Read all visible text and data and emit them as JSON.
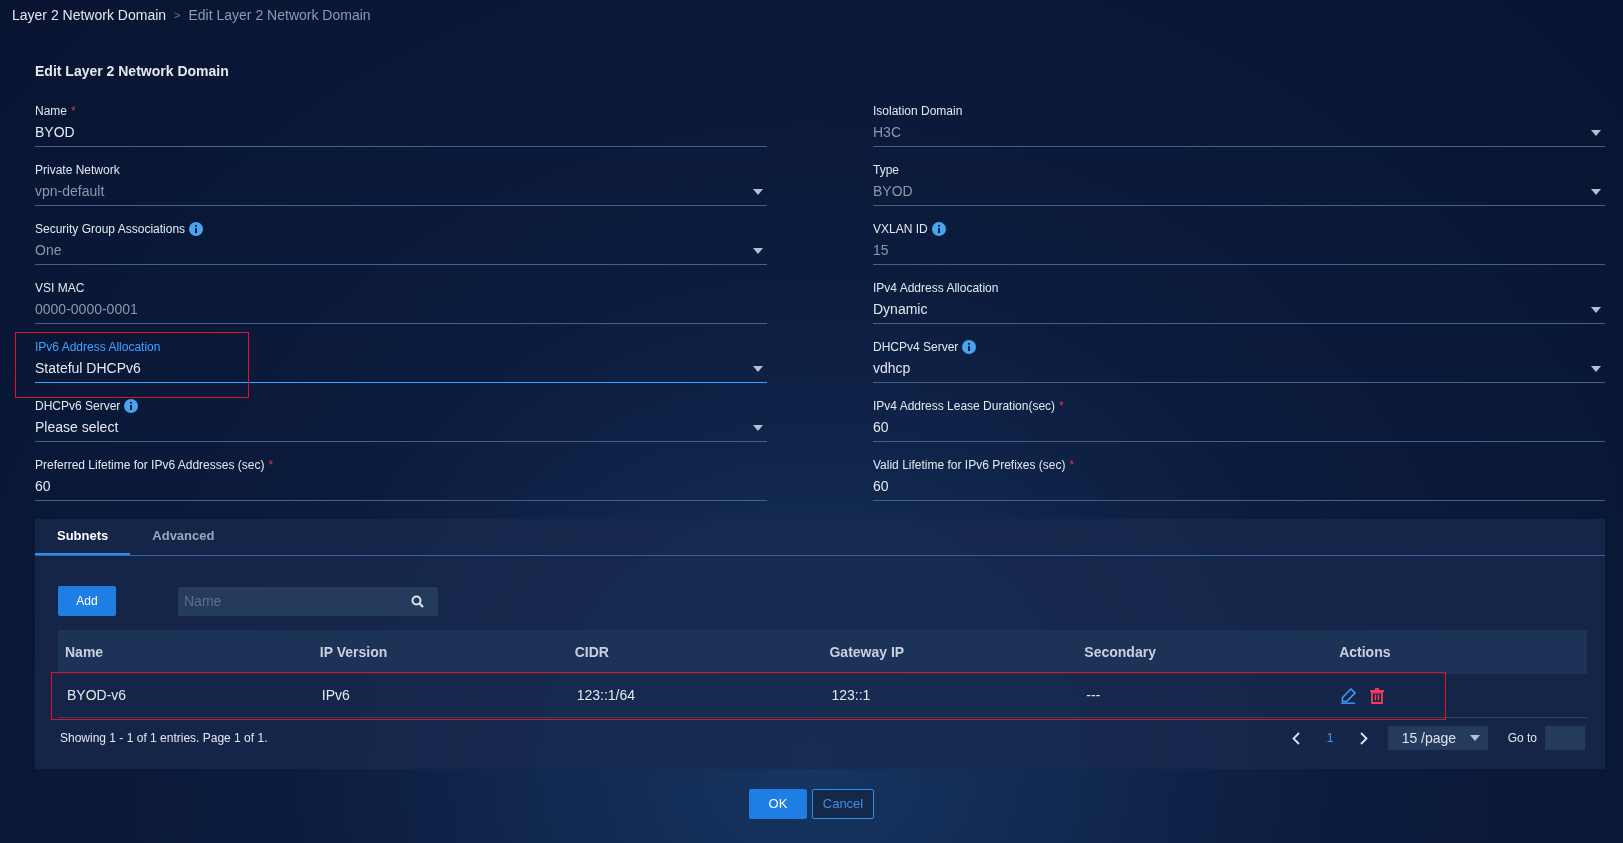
{
  "breadcrumb": [
    {
      "label": "Layer 2 Network Domain",
      "current": false
    },
    {
      "label": "Edit Layer 2 Network Domain",
      "current": true
    }
  ],
  "breadcrumb_separator": ">",
  "title": "Edit Layer 2 Network Domain",
  "fields": [
    {
      "label": "Name",
      "kind": "text",
      "value": "BYOD",
      "required_mark": "*",
      "info": false,
      "disabled": false,
      "focused": false,
      "highlighted": false
    },
    {
      "label": "Isolation Domain",
      "kind": "select",
      "value": "H3C",
      "info": false,
      "disabled": true,
      "focused": false,
      "highlighted": false
    },
    {
      "label": "Private Network",
      "kind": "select",
      "value": "vpn-default",
      "info": false,
      "disabled": true,
      "focused": false,
      "highlighted": false
    },
    {
      "label": "Type",
      "kind": "select",
      "value": "BYOD",
      "info": false,
      "disabled": true,
      "focused": false,
      "highlighted": false
    },
    {
      "label": "Security Group Associations",
      "kind": "select",
      "value": "One",
      "info": true,
      "disabled": true,
      "focused": false,
      "highlighted": false
    },
    {
      "label": "VXLAN ID",
      "kind": "text",
      "value": "15",
      "info": true,
      "disabled": true,
      "focused": false,
      "highlighted": false
    },
    {
      "label": "VSI MAC",
      "kind": "text",
      "value": "0000-0000-0001",
      "info": false,
      "disabled": true,
      "focused": false,
      "highlighted": false
    },
    {
      "label": "IPv4 Address Allocation",
      "kind": "select",
      "value": "Dynamic",
      "info": false,
      "disabled": false,
      "focused": false,
      "highlighted": false
    },
    {
      "label": "IPv6 Address Allocation",
      "kind": "select",
      "value": "Stateful DHCPv6",
      "info": false,
      "disabled": false,
      "focused": true,
      "highlighted": true
    },
    {
      "label": "DHCPv4 Server",
      "kind": "select",
      "value": "vdhcp",
      "info": true,
      "disabled": false,
      "focused": false,
      "highlighted": false
    },
    {
      "label": "DHCPv6 Server",
      "kind": "select",
      "value": "Please select",
      "info": true,
      "disabled": false,
      "focused": false,
      "highlighted": false
    },
    {
      "label": "IPv4 Address Lease Duration(sec)",
      "kind": "text",
      "value": "60",
      "required_mark": "*",
      "info": false,
      "disabled": false,
      "focused": false,
      "highlighted": false
    },
    {
      "label": "Preferred Lifetime for IPv6 Addresses (sec)",
      "kind": "text",
      "value": "60",
      "required_mark": "*",
      "info": false,
      "disabled": false,
      "focused": false,
      "highlighted": false
    },
    {
      "label": "Valid Lifetime for IPv6 Prefixes (sec)",
      "kind": "text",
      "value": "60",
      "required_mark": "*",
      "info": false,
      "disabled": false,
      "focused": false,
      "highlighted": false
    }
  ],
  "tabs": [
    {
      "label": "Subnets",
      "selected": true
    },
    {
      "label": "Advanced",
      "selected": false
    }
  ],
  "add_button": "Add",
  "search": {
    "placeholder": "Name"
  },
  "table": {
    "columns": [
      "Name",
      "IP Version",
      "CIDR",
      "Gateway IP",
      "Secondary",
      "Actions"
    ],
    "rows": [
      {
        "cells": [
          "BYOD-v6",
          "IPv6",
          "123::1/64",
          "123::1",
          "---"
        ],
        "highlighted": true
      }
    ]
  },
  "summary": "Showing 1 - 1 of 1 entries. Page 1 of 1.",
  "pagination": {
    "pages": [
      {
        "label": "1",
        "selected": true
      }
    ],
    "page_size": "15 /page",
    "goto_label": "Go to"
  },
  "buttons": [
    {
      "label": "OK",
      "kind": "primary"
    },
    {
      "label": "Cancel",
      "kind": "secondary"
    }
  ]
}
